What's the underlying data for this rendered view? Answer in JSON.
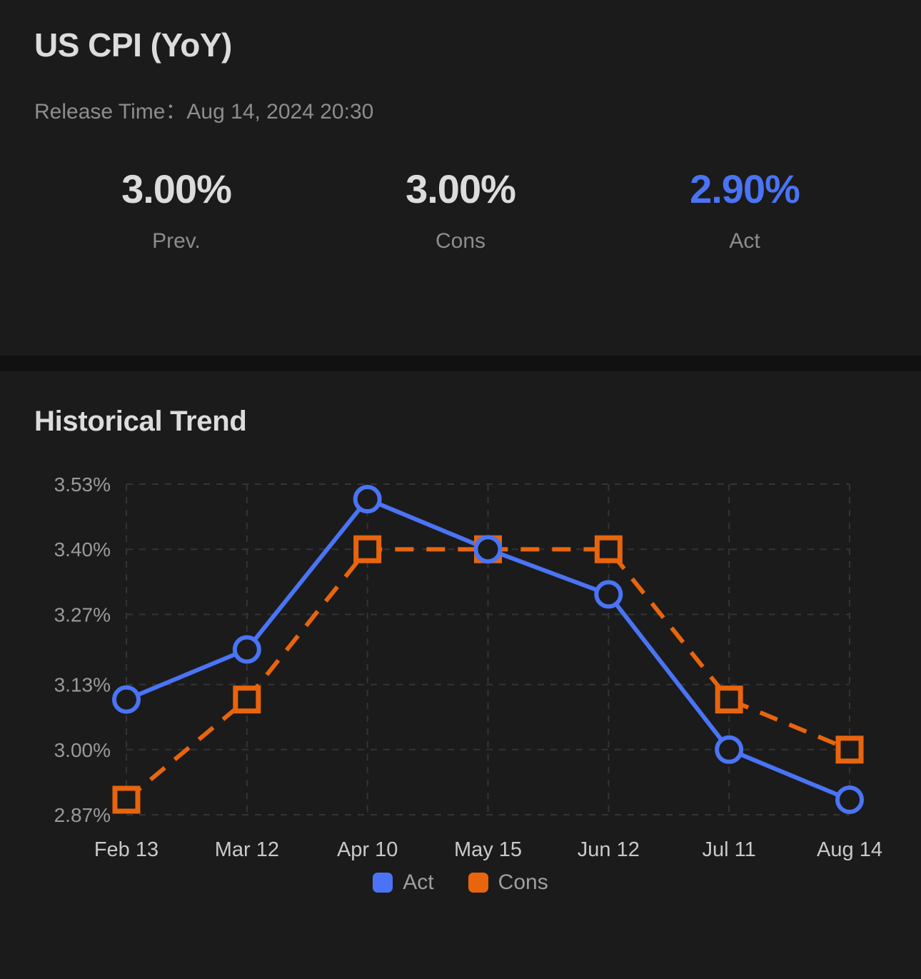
{
  "header": {
    "title": "US CPI (YoY)",
    "release_label": "Release Time：",
    "release_value": "Aug 14, 2024 20:30"
  },
  "stats": [
    {
      "value": "3.00%",
      "label": "Prev.",
      "accent": false
    },
    {
      "value": "3.00%",
      "label": "Cons",
      "accent": false
    },
    {
      "value": "2.90%",
      "label": "Act",
      "accent": true
    }
  ],
  "trend": {
    "title": "Historical Trend"
  },
  "colors": {
    "act": "#4a74f5",
    "cons": "#e8650d",
    "background": "#1b1b1b",
    "separator": "#111111",
    "grid": "#343434",
    "text_primary": "#dcdcdc",
    "text_muted": "#8d8d8d"
  },
  "legend": [
    {
      "label": "Act",
      "color": "#4a74f5"
    },
    {
      "label": "Cons",
      "color": "#e8650d"
    }
  ],
  "chart_data": {
    "type": "line",
    "title": "Historical Trend",
    "xlabel": "",
    "ylabel": "",
    "grid": true,
    "legend_position": "bottom-center",
    "categories": [
      "Feb 13",
      "Mar 12",
      "Apr 10",
      "May 15",
      "Jun 12",
      "Jul 11",
      "Aug 14"
    ],
    "ytick_labels": [
      "3.53%",
      "3.40%",
      "3.27%",
      "3.13%",
      "3.00%",
      "2.87%"
    ],
    "ytick_values": [
      3.53,
      3.4,
      3.27,
      3.13,
      3.0,
      2.87
    ],
    "ylim": [
      2.87,
      3.53
    ],
    "series": [
      {
        "name": "Act",
        "color": "#4a74f5",
        "style": "solid",
        "marker": "circle",
        "values": [
          3.1,
          3.2,
          3.5,
          3.4,
          3.31,
          3.0,
          2.9
        ]
      },
      {
        "name": "Cons",
        "color": "#e8650d",
        "style": "dashed",
        "marker": "square",
        "values": [
          2.9,
          3.1,
          3.4,
          3.4,
          3.4,
          3.1,
          3.0
        ]
      }
    ]
  }
}
